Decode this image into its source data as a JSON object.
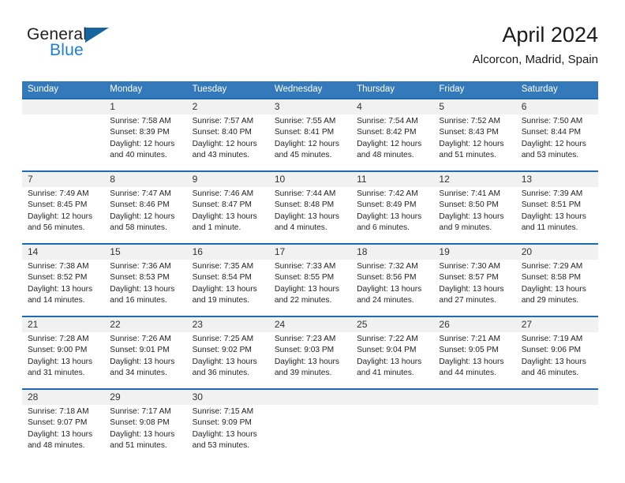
{
  "brand": {
    "name_part1": "General",
    "name_part2": "Blue",
    "mark": "triangle-logo",
    "color_dark": "#231f20",
    "color_blue": "#1c7fd4",
    "color_mark": "#17649f"
  },
  "header": {
    "title": "April 2024",
    "location": "Alcorcon, Madrid, Spain"
  },
  "theme": {
    "header_row_bg": "#3479b9",
    "week_divider": "#1e6bb0",
    "daynum_band_bg": "#f1f1f1",
    "text": "#231f20"
  },
  "weekdays": [
    "Sunday",
    "Monday",
    "Tuesday",
    "Wednesday",
    "Thursday",
    "Friday",
    "Saturday"
  ],
  "weeks": [
    [
      {
        "day": "",
        "sunrise": "",
        "sunset": "",
        "daylight1": "",
        "daylight2": ""
      },
      {
        "day": "1",
        "sunrise": "Sunrise: 7:58 AM",
        "sunset": "Sunset: 8:39 PM",
        "daylight1": "Daylight: 12 hours",
        "daylight2": "and 40 minutes."
      },
      {
        "day": "2",
        "sunrise": "Sunrise: 7:57 AM",
        "sunset": "Sunset: 8:40 PM",
        "daylight1": "Daylight: 12 hours",
        "daylight2": "and 43 minutes."
      },
      {
        "day": "3",
        "sunrise": "Sunrise: 7:55 AM",
        "sunset": "Sunset: 8:41 PM",
        "daylight1": "Daylight: 12 hours",
        "daylight2": "and 45 minutes."
      },
      {
        "day": "4",
        "sunrise": "Sunrise: 7:54 AM",
        "sunset": "Sunset: 8:42 PM",
        "daylight1": "Daylight: 12 hours",
        "daylight2": "and 48 minutes."
      },
      {
        "day": "5",
        "sunrise": "Sunrise: 7:52 AM",
        "sunset": "Sunset: 8:43 PM",
        "daylight1": "Daylight: 12 hours",
        "daylight2": "and 51 minutes."
      },
      {
        "day": "6",
        "sunrise": "Sunrise: 7:50 AM",
        "sunset": "Sunset: 8:44 PM",
        "daylight1": "Daylight: 12 hours",
        "daylight2": "and 53 minutes."
      }
    ],
    [
      {
        "day": "7",
        "sunrise": "Sunrise: 7:49 AM",
        "sunset": "Sunset: 8:45 PM",
        "daylight1": "Daylight: 12 hours",
        "daylight2": "and 56 minutes."
      },
      {
        "day": "8",
        "sunrise": "Sunrise: 7:47 AM",
        "sunset": "Sunset: 8:46 PM",
        "daylight1": "Daylight: 12 hours",
        "daylight2": "and 58 minutes."
      },
      {
        "day": "9",
        "sunrise": "Sunrise: 7:46 AM",
        "sunset": "Sunset: 8:47 PM",
        "daylight1": "Daylight: 13 hours",
        "daylight2": "and 1 minute."
      },
      {
        "day": "10",
        "sunrise": "Sunrise: 7:44 AM",
        "sunset": "Sunset: 8:48 PM",
        "daylight1": "Daylight: 13 hours",
        "daylight2": "and 4 minutes."
      },
      {
        "day": "11",
        "sunrise": "Sunrise: 7:42 AM",
        "sunset": "Sunset: 8:49 PM",
        "daylight1": "Daylight: 13 hours",
        "daylight2": "and 6 minutes."
      },
      {
        "day": "12",
        "sunrise": "Sunrise: 7:41 AM",
        "sunset": "Sunset: 8:50 PM",
        "daylight1": "Daylight: 13 hours",
        "daylight2": "and 9 minutes."
      },
      {
        "day": "13",
        "sunrise": "Sunrise: 7:39 AM",
        "sunset": "Sunset: 8:51 PM",
        "daylight1": "Daylight: 13 hours",
        "daylight2": "and 11 minutes."
      }
    ],
    [
      {
        "day": "14",
        "sunrise": "Sunrise: 7:38 AM",
        "sunset": "Sunset: 8:52 PM",
        "daylight1": "Daylight: 13 hours",
        "daylight2": "and 14 minutes."
      },
      {
        "day": "15",
        "sunrise": "Sunrise: 7:36 AM",
        "sunset": "Sunset: 8:53 PM",
        "daylight1": "Daylight: 13 hours",
        "daylight2": "and 16 minutes."
      },
      {
        "day": "16",
        "sunrise": "Sunrise: 7:35 AM",
        "sunset": "Sunset: 8:54 PM",
        "daylight1": "Daylight: 13 hours",
        "daylight2": "and 19 minutes."
      },
      {
        "day": "17",
        "sunrise": "Sunrise: 7:33 AM",
        "sunset": "Sunset: 8:55 PM",
        "daylight1": "Daylight: 13 hours",
        "daylight2": "and 22 minutes."
      },
      {
        "day": "18",
        "sunrise": "Sunrise: 7:32 AM",
        "sunset": "Sunset: 8:56 PM",
        "daylight1": "Daylight: 13 hours",
        "daylight2": "and 24 minutes."
      },
      {
        "day": "19",
        "sunrise": "Sunrise: 7:30 AM",
        "sunset": "Sunset: 8:57 PM",
        "daylight1": "Daylight: 13 hours",
        "daylight2": "and 27 minutes."
      },
      {
        "day": "20",
        "sunrise": "Sunrise: 7:29 AM",
        "sunset": "Sunset: 8:58 PM",
        "daylight1": "Daylight: 13 hours",
        "daylight2": "and 29 minutes."
      }
    ],
    [
      {
        "day": "21",
        "sunrise": "Sunrise: 7:28 AM",
        "sunset": "Sunset: 9:00 PM",
        "daylight1": "Daylight: 13 hours",
        "daylight2": "and 31 minutes."
      },
      {
        "day": "22",
        "sunrise": "Sunrise: 7:26 AM",
        "sunset": "Sunset: 9:01 PM",
        "daylight1": "Daylight: 13 hours",
        "daylight2": "and 34 minutes."
      },
      {
        "day": "23",
        "sunrise": "Sunrise: 7:25 AM",
        "sunset": "Sunset: 9:02 PM",
        "daylight1": "Daylight: 13 hours",
        "daylight2": "and 36 minutes."
      },
      {
        "day": "24",
        "sunrise": "Sunrise: 7:23 AM",
        "sunset": "Sunset: 9:03 PM",
        "daylight1": "Daylight: 13 hours",
        "daylight2": "and 39 minutes."
      },
      {
        "day": "25",
        "sunrise": "Sunrise: 7:22 AM",
        "sunset": "Sunset: 9:04 PM",
        "daylight1": "Daylight: 13 hours",
        "daylight2": "and 41 minutes."
      },
      {
        "day": "26",
        "sunrise": "Sunrise: 7:21 AM",
        "sunset": "Sunset: 9:05 PM",
        "daylight1": "Daylight: 13 hours",
        "daylight2": "and 44 minutes."
      },
      {
        "day": "27",
        "sunrise": "Sunrise: 7:19 AM",
        "sunset": "Sunset: 9:06 PM",
        "daylight1": "Daylight: 13 hours",
        "daylight2": "and 46 minutes."
      }
    ],
    [
      {
        "day": "28",
        "sunrise": "Sunrise: 7:18 AM",
        "sunset": "Sunset: 9:07 PM",
        "daylight1": "Daylight: 13 hours",
        "daylight2": "and 48 minutes."
      },
      {
        "day": "29",
        "sunrise": "Sunrise: 7:17 AM",
        "sunset": "Sunset: 9:08 PM",
        "daylight1": "Daylight: 13 hours",
        "daylight2": "and 51 minutes."
      },
      {
        "day": "30",
        "sunrise": "Sunrise: 7:15 AM",
        "sunset": "Sunset: 9:09 PM",
        "daylight1": "Daylight: 13 hours",
        "daylight2": "and 53 minutes."
      },
      {
        "day": "",
        "sunrise": "",
        "sunset": "",
        "daylight1": "",
        "daylight2": ""
      },
      {
        "day": "",
        "sunrise": "",
        "sunset": "",
        "daylight1": "",
        "daylight2": ""
      },
      {
        "day": "",
        "sunrise": "",
        "sunset": "",
        "daylight1": "",
        "daylight2": ""
      },
      {
        "day": "",
        "sunrise": "",
        "sunset": "",
        "daylight1": "",
        "daylight2": ""
      }
    ]
  ]
}
